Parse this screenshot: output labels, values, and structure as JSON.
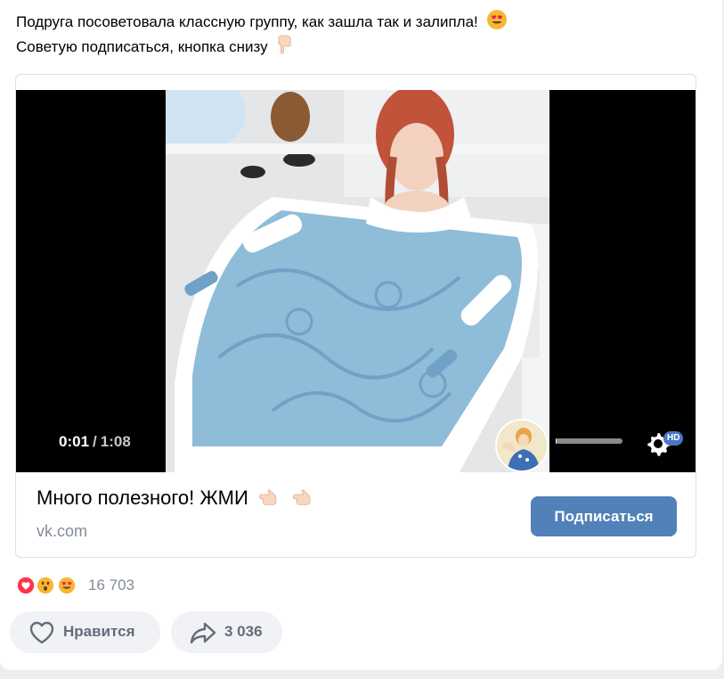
{
  "post": {
    "text_line1": "Подруга посоветовала классную группу, как зашла так и залипла!",
    "text_line2": "Советую подписаться, кнопка снизу"
  },
  "video": {
    "current_time": "0:01",
    "separator": "/",
    "duration": "1:08",
    "progress_fraction": 0.015,
    "quality_badge": "HD"
  },
  "card": {
    "title": "Много полезного! ЖМИ",
    "domain": "vk.com",
    "subscribe_label": "Подписаться"
  },
  "reactions": {
    "count": "16 703",
    "icons": [
      "heart-reaction",
      "surprised-reaction",
      "heart-eyes-reaction"
    ]
  },
  "actions": {
    "like_label": "Нравится",
    "share_count": "3 036"
  },
  "colors": {
    "accent": "#5181b8",
    "muted_text": "#818c99",
    "button_bg": "#f0f2f5"
  }
}
